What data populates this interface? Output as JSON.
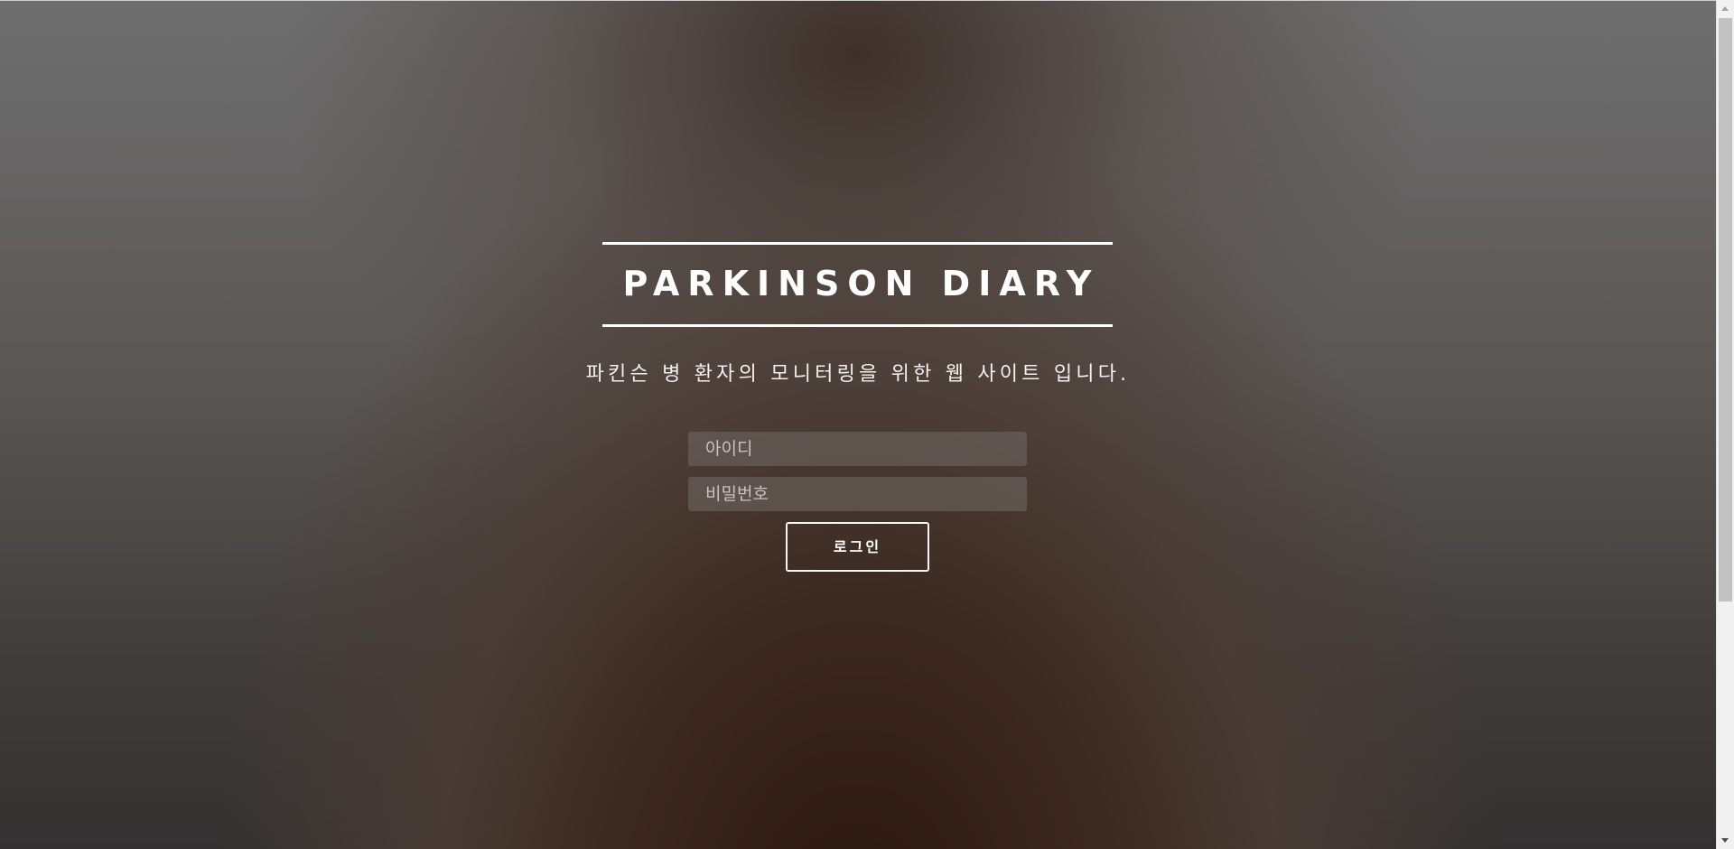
{
  "header": {
    "title": "PARKINSON DIARY",
    "subtitle": "파킨슨 병 환자의 모니터링을 위한 웹 사이트 입니다."
  },
  "login_form": {
    "id_placeholder": "아이디",
    "password_placeholder": "비밀번호",
    "login_label": "로그인"
  },
  "colors": {
    "text": "#ffffff",
    "background_center": "#2a170d",
    "background_edge": "#6f6f70",
    "input_background": "#6c6460"
  }
}
